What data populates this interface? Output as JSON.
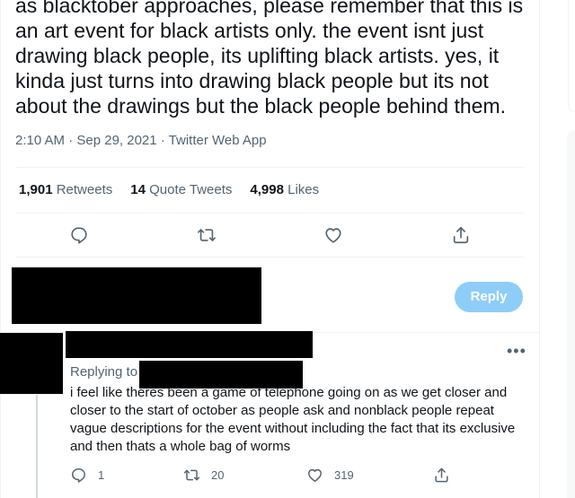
{
  "tweet": {
    "text": "as blacktober approaches, please remember that this is an art event for black artists only. the event isnt just drawing black people, its uplifting black artists. yes, it kinda just turns into drawing black people but its not about the drawings but the black people behind them.",
    "meta": "2:10 AM · Sep 29, 2021 · Twitter Web App",
    "stats": {
      "retweets_count": "1,901",
      "retweets_label": "Retweets",
      "quotes_count": "14",
      "quotes_label": "Quote Tweets",
      "likes_count": "4,998",
      "likes_label": "Likes"
    },
    "actions": [
      "reply-icon",
      "retweet-icon",
      "like-icon",
      "share-icon"
    ]
  },
  "compose": {
    "reply_button_label": "Reply"
  },
  "reply_tweet": {
    "replying_to_label": "Replying to",
    "text": "i feel like theres been a game of telephone going on as we get closer and closer to the start of october as people ask and nonblack people repeat vague descriptions for the event without including the fact that its exclusive and then thats a whole bag of worms",
    "more_label": "•••",
    "reply_count": "1",
    "retweet_count": "20",
    "like_count": "319"
  }
}
